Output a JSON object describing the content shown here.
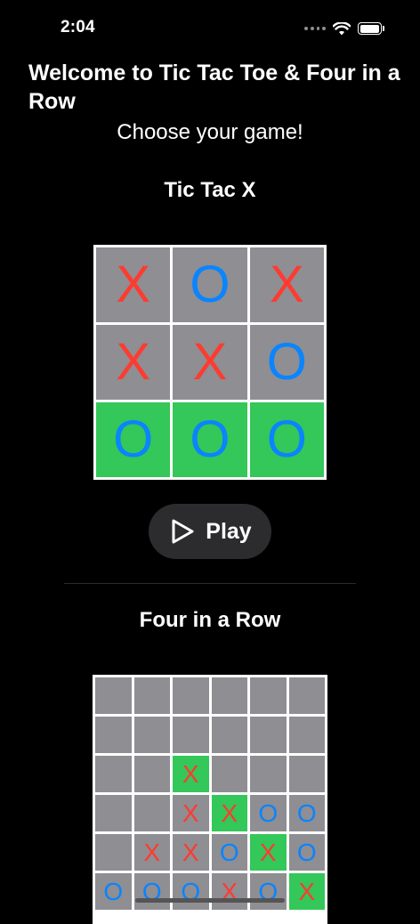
{
  "status_bar": {
    "time": "2:04"
  },
  "header": {
    "welcome": "Welcome to Tic Tac Toe & Four in a Row",
    "subtitle": "Choose your game!"
  },
  "tic_tac": {
    "title": "Tic Tac X",
    "board": [
      [
        "X",
        "O",
        "X"
      ],
      [
        "X",
        "X",
        "O"
      ],
      [
        "O",
        "O",
        "O"
      ]
    ],
    "winning_row": 2,
    "play_label": "Play"
  },
  "four_in_a_row": {
    "title": "Four in a Row",
    "rows": [
      [
        "",
        "",
        "",
        "",
        "",
        ""
      ],
      [
        "",
        "",
        "",
        "",
        "",
        ""
      ],
      [
        "",
        "",
        "X",
        "",
        "",
        ""
      ],
      [
        "",
        "",
        "X",
        "X",
        "O",
        "O"
      ],
      [
        "",
        "X",
        "X",
        "O",
        "X",
        "O"
      ],
      [
        "O",
        "O",
        "O",
        "X",
        "O",
        "X"
      ]
    ],
    "winning_cells": [
      [
        2,
        2
      ],
      [
        3,
        3
      ],
      [
        4,
        4
      ],
      [
        5,
        5
      ]
    ]
  },
  "colors": {
    "x_mark": "#ff3b30",
    "o_mark": "#0a84ff",
    "cell": "#8e8e93",
    "win": "#34c759",
    "background": "#000000"
  },
  "icons": {
    "play": "play-icon",
    "signal": "signal-icon",
    "wifi": "wifi-icon",
    "battery": "battery-icon"
  }
}
